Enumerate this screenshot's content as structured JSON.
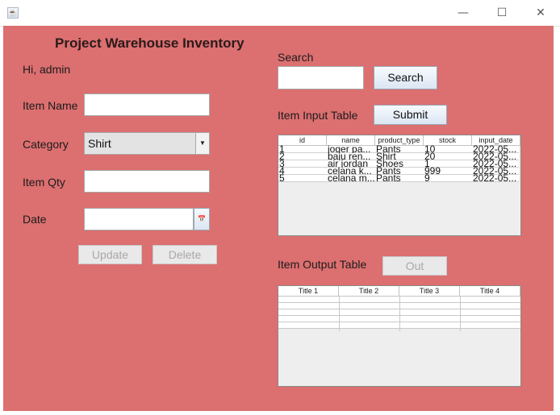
{
  "window": {
    "app_icon": "java-icon",
    "minimize_icon": "minimize-icon",
    "maximize_icon": "maximize-icon",
    "close_icon": "close-icon"
  },
  "form": {
    "title": "Project Warehouse Inventory",
    "greeting": "Hi, admin",
    "item_name_label": "Item Name",
    "item_name_value": "",
    "category_label": "Category",
    "category_value": "Shirt",
    "item_qty_label": "Item Qty",
    "item_qty_value": "",
    "date_label": "Date",
    "date_value": "",
    "update_label": "Update",
    "delete_label": "Delete"
  },
  "search": {
    "label": "Search",
    "value": "",
    "button_label": "Search"
  },
  "input_table": {
    "label": "Item Input Table",
    "submit_label": "Submit",
    "columns": [
      "id",
      "name",
      "product_type",
      "stock",
      "input_date"
    ],
    "rows": [
      [
        "1",
        "joger pa...",
        "Pants",
        "10",
        "2022-05..."
      ],
      [
        "2",
        "baju ren...",
        "Shirt",
        "20",
        "2022-05..."
      ],
      [
        "3",
        "air jordan",
        "Shoes",
        "1",
        "2022-05..."
      ],
      [
        "4",
        "celana k...",
        "Pants",
        "999",
        "2022-05..."
      ],
      [
        "5",
        "celana m...",
        "Pants",
        "9",
        "2022-05..."
      ]
    ]
  },
  "output_table": {
    "label": "Item Output Table",
    "out_label": "Out",
    "columns": [
      "Title 1",
      "Title 2",
      "Title 3",
      "Title 4"
    ]
  },
  "colors": {
    "background": "#dc6f70",
    "button_gradient_top": "#f7fafe",
    "button_gradient_bottom": "#dbe6f3"
  }
}
